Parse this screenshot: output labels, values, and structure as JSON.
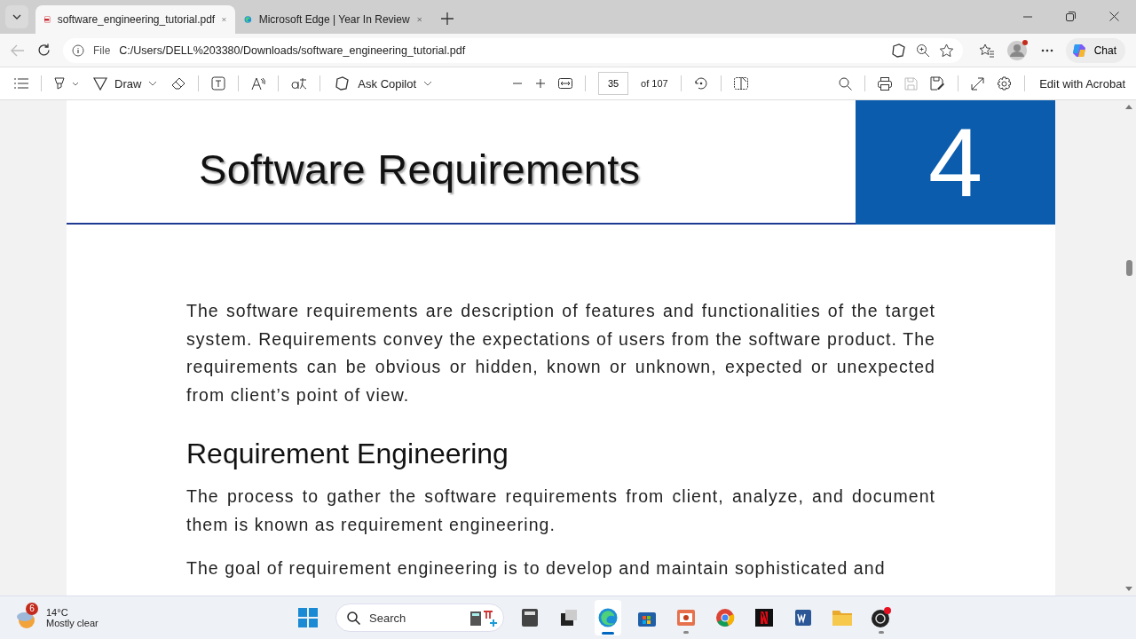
{
  "tabs": [
    {
      "title": "software_engineering_tutorial.pdf",
      "kind": "pdf",
      "selected": true
    },
    {
      "title": "Microsoft Edge | Year In Review",
      "kind": "edge",
      "selected": false
    }
  ],
  "address": {
    "scheme": "File",
    "url": "C:/Users/DELL%203380/Downloads/software_engineering_tutorial.pdf"
  },
  "chat": "Chat",
  "pdf_toolbar": {
    "draw": "Draw",
    "copilot": "Ask Copilot",
    "page": "35",
    "page_count": "of 107",
    "save_disabled": true,
    "edit": "Edit with Acrobat"
  },
  "document": {
    "title": "Software Requirements",
    "chapter": "4",
    "blocks": [
      {
        "kind": "para",
        "text": "The software requirements are description of features and functionalities of the target system. Requirements convey the expectations of users from the software product. The requirements can be obvious or hidden, known or unknown, expected or unexpected from client’s point of view."
      },
      {
        "kind": "heading",
        "text": "Requirement Engineering"
      },
      {
        "kind": "para",
        "text": "The process to gather the software requirements from client, analyze, and document them is known as requirement engineering."
      },
      {
        "kind": "para",
        "text": "The goal of requirement engineering is to develop and maintain sophisticated and"
      }
    ]
  },
  "taskbar": {
    "weather": {
      "badge": "6",
      "temp": "14°C",
      "condition": "Mostly clear"
    },
    "search": "Search",
    "apps": [
      {
        "kind": "calculator",
        "selected": false,
        "running": false
      },
      {
        "kind": "taskview",
        "selected": false,
        "running": false
      },
      {
        "kind": "edge",
        "selected": true,
        "running": true
      },
      {
        "kind": "store",
        "selected": false,
        "running": false
      },
      {
        "kind": "powerpoint",
        "selected": false,
        "running": true
      },
      {
        "kind": "chrome",
        "selected": false,
        "running": false
      },
      {
        "kind": "netflix",
        "selected": false,
        "running": false
      },
      {
        "kind": "word",
        "selected": false,
        "running": false
      },
      {
        "kind": "folder",
        "selected": false,
        "running": false
      },
      {
        "kind": "obs",
        "selected": false,
        "running": true
      }
    ]
  }
}
